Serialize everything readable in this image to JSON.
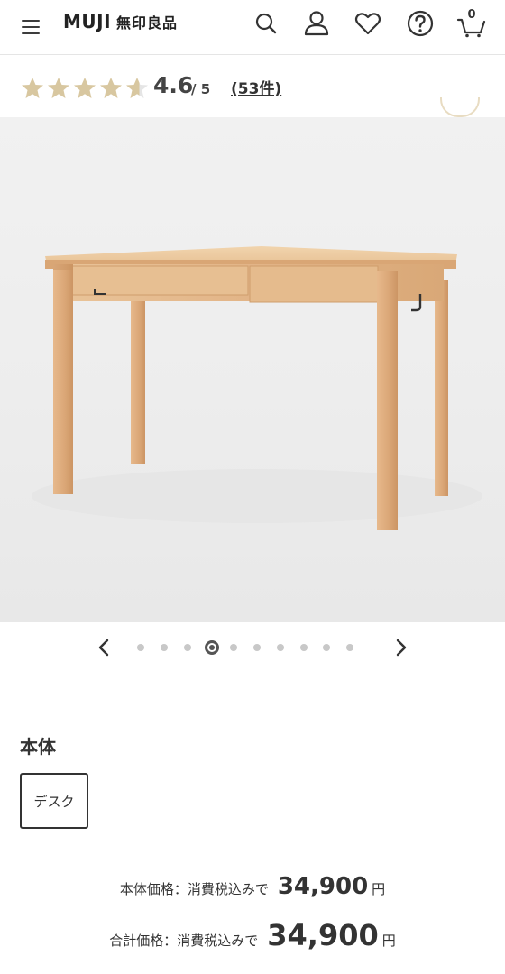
{
  "header": {
    "logo_text": "MUJI",
    "logo_jp": "無印良品",
    "icons": [
      "menu-icon",
      "search-icon",
      "account-icon",
      "heart-icon",
      "help-icon",
      "cart-icon"
    ],
    "cart_count": "0"
  },
  "rating": {
    "stars_value": 4.6,
    "score": "4.6",
    "score_max": "/ 5",
    "review_count": "(53件)",
    "star_color": "#d8c7a0",
    "star_empty_color": "#e5e5e5"
  },
  "carousel": {
    "total_slides": 10,
    "active_slide": 4,
    "prev_icon": "chevron-left-icon",
    "next_icon": "chevron-right-icon"
  },
  "variant": {
    "section_label": "本体",
    "options": [
      "デスク"
    ],
    "selected": "デスク"
  },
  "prices": {
    "body_label": "本体価格：消費税込みで",
    "body_value": "34,900",
    "body_unit": "円",
    "total_label": "合計価格：消費税込みで",
    "total_value": "34,900",
    "total_unit": "円"
  }
}
